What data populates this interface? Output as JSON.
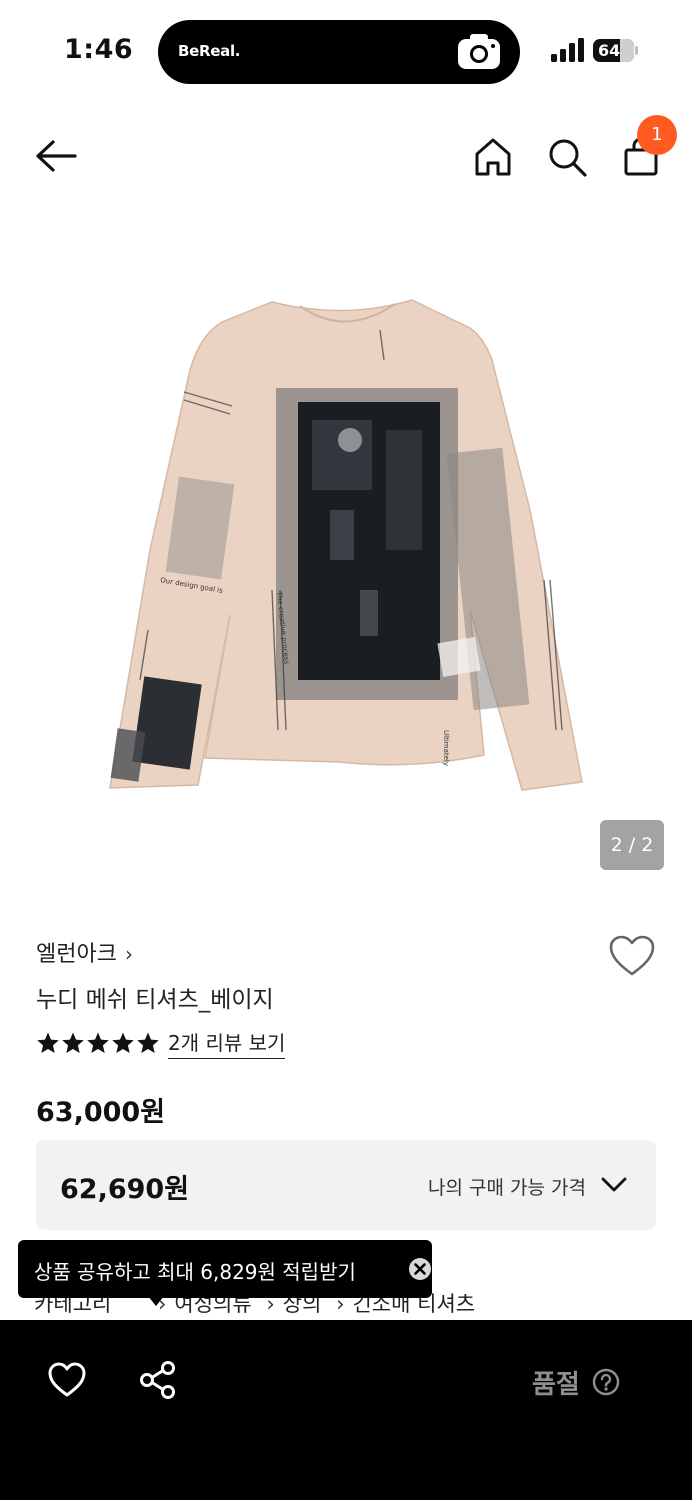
{
  "status_bar": {
    "time": "1:46",
    "island_app": "BeReal.",
    "battery": "64"
  },
  "nav": {
    "cart_count": "1"
  },
  "gallery": {
    "page_indicator": "2 / 2",
    "print_texts": [
      "Our design goal is",
      "The creative process",
      "Ultimately"
    ]
  },
  "product": {
    "brand": "엘런아크",
    "brand_chevron": "›",
    "name": "누디 메쉬 티셔츠_베이지",
    "rating": 5,
    "review_link": "2개 리뷰 보기",
    "price": "63,000원"
  },
  "my_price": {
    "value": "62,690원",
    "label": "나의 구매 가능 가격"
  },
  "category": {
    "items": [
      "카테고리",
      "여성의류",
      "상의",
      "긴소매 티셔츠"
    ],
    "separator": "›"
  },
  "tooltip": {
    "text": "상품 공유하고 최대 6,829원 적립받기"
  },
  "bottom_bar": {
    "status_label": "품절"
  },
  "colors": {
    "accent_badge": "#ff5a1f",
    "shirt_beige": "#ead3c2",
    "bottom_bar": "#000000",
    "soldout_text": "#8f8f8f"
  },
  "icons": [
    "back-arrow-icon",
    "home-icon",
    "search-icon",
    "shopping-bag-icon",
    "heart-icon",
    "share-icon",
    "close-icon",
    "help-icon",
    "chevron-down-icon",
    "star-icon",
    "camera-icon"
  ]
}
